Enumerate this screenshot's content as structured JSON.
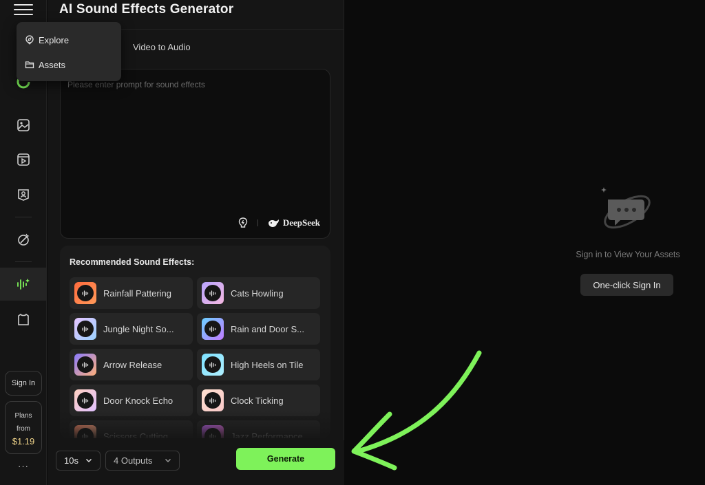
{
  "app": {
    "title": "AI Sound Effects Generator"
  },
  "menu": {
    "items": [
      {
        "label": "Explore",
        "icon": "explore-icon"
      },
      {
        "label": "Assets",
        "icon": "folder-icon"
      }
    ]
  },
  "tabs": {
    "video_to_audio": "Video to Audio"
  },
  "prompt": {
    "placeholder": "Please enter prompt for sound effects",
    "model_label": "DeepSeek"
  },
  "recommended": {
    "title": "Recommended Sound Effects:",
    "items": [
      {
        "label": "Rainfall Pattering"
      },
      {
        "label": "Cats Howling"
      },
      {
        "label": "Jungle Night So..."
      },
      {
        "label": "Rain and Door S..."
      },
      {
        "label": "Arrow Release"
      },
      {
        "label": "High Heels on Tile"
      },
      {
        "label": "Door Knock Echo"
      },
      {
        "label": "Clock Ticking"
      },
      {
        "label": "Scissors Cutting"
      },
      {
        "label": "Jazz Performance"
      }
    ]
  },
  "footer": {
    "duration": "10s",
    "outputs": "4 Outputs",
    "generate_label": "Generate"
  },
  "rail": {
    "signin_label": "Sign In",
    "plans_line1": "Plans",
    "plans_line2": "from",
    "plans_price": "$1.19",
    "more": "···"
  },
  "right": {
    "empty_text": "Sign in to View Your Assets",
    "signin_button": "One-click Sign In"
  },
  "colors": {
    "accent": "#7ef25a",
    "price": "#f0d48a",
    "background": "#0b0b0b",
    "panel": "#151515"
  }
}
